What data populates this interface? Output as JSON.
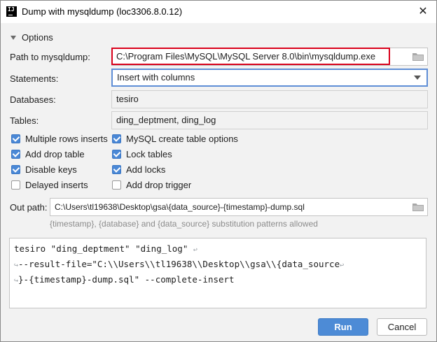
{
  "window": {
    "title": "Dump with mysqldump (loc3306.8.0.12)",
    "close_glyph": "✕"
  },
  "options": {
    "section_label": "Options",
    "path": {
      "label": "Path to mysqldump:",
      "value": "C:\\Program Files\\MySQL\\MySQL Server 8.0\\bin\\mysqldump.exe"
    },
    "statements": {
      "label": "Statements:",
      "selected": "Insert with columns"
    },
    "databases": {
      "label": "Databases:",
      "value": "tesiro"
    },
    "tables": {
      "label": "Tables:",
      "value": "ding_deptment, ding_log"
    },
    "checkboxes": [
      {
        "label": "Multiple rows inserts",
        "checked": true
      },
      {
        "label": "MySQL create table options",
        "checked": true
      },
      {
        "label": "Add drop table",
        "checked": true
      },
      {
        "label": "Lock tables",
        "checked": true
      },
      {
        "label": "Disable keys",
        "checked": true
      },
      {
        "label": "Add locks",
        "checked": true
      },
      {
        "label": "Delayed inserts",
        "checked": false
      },
      {
        "label": "Add drop trigger",
        "checked": false
      }
    ]
  },
  "out_path": {
    "label": "Out path:",
    "value": "C:\\Users\\tl19638\\Desktop\\gsa\\{data_source}-{timestamp}-dump.sql",
    "hint": "{timestamp}, {database} and {data_source} substitution patterns allowed"
  },
  "command": {
    "lines": [
      "tesiro \"ding_deptment\" \"ding_log\"",
      "--result-file=\"C:\\\\Users\\\\tl19638\\\\Desktop\\\\gsa\\\\{data_source",
      "}-{timestamp}-dump.sql\" --complete-insert"
    ]
  },
  "buttons": {
    "run": "Run",
    "cancel": "Cancel"
  },
  "colors": {
    "primary_button": "#4d8bd6",
    "checkbox_on": "#4a88d6",
    "highlight_box": "#d9001b"
  }
}
